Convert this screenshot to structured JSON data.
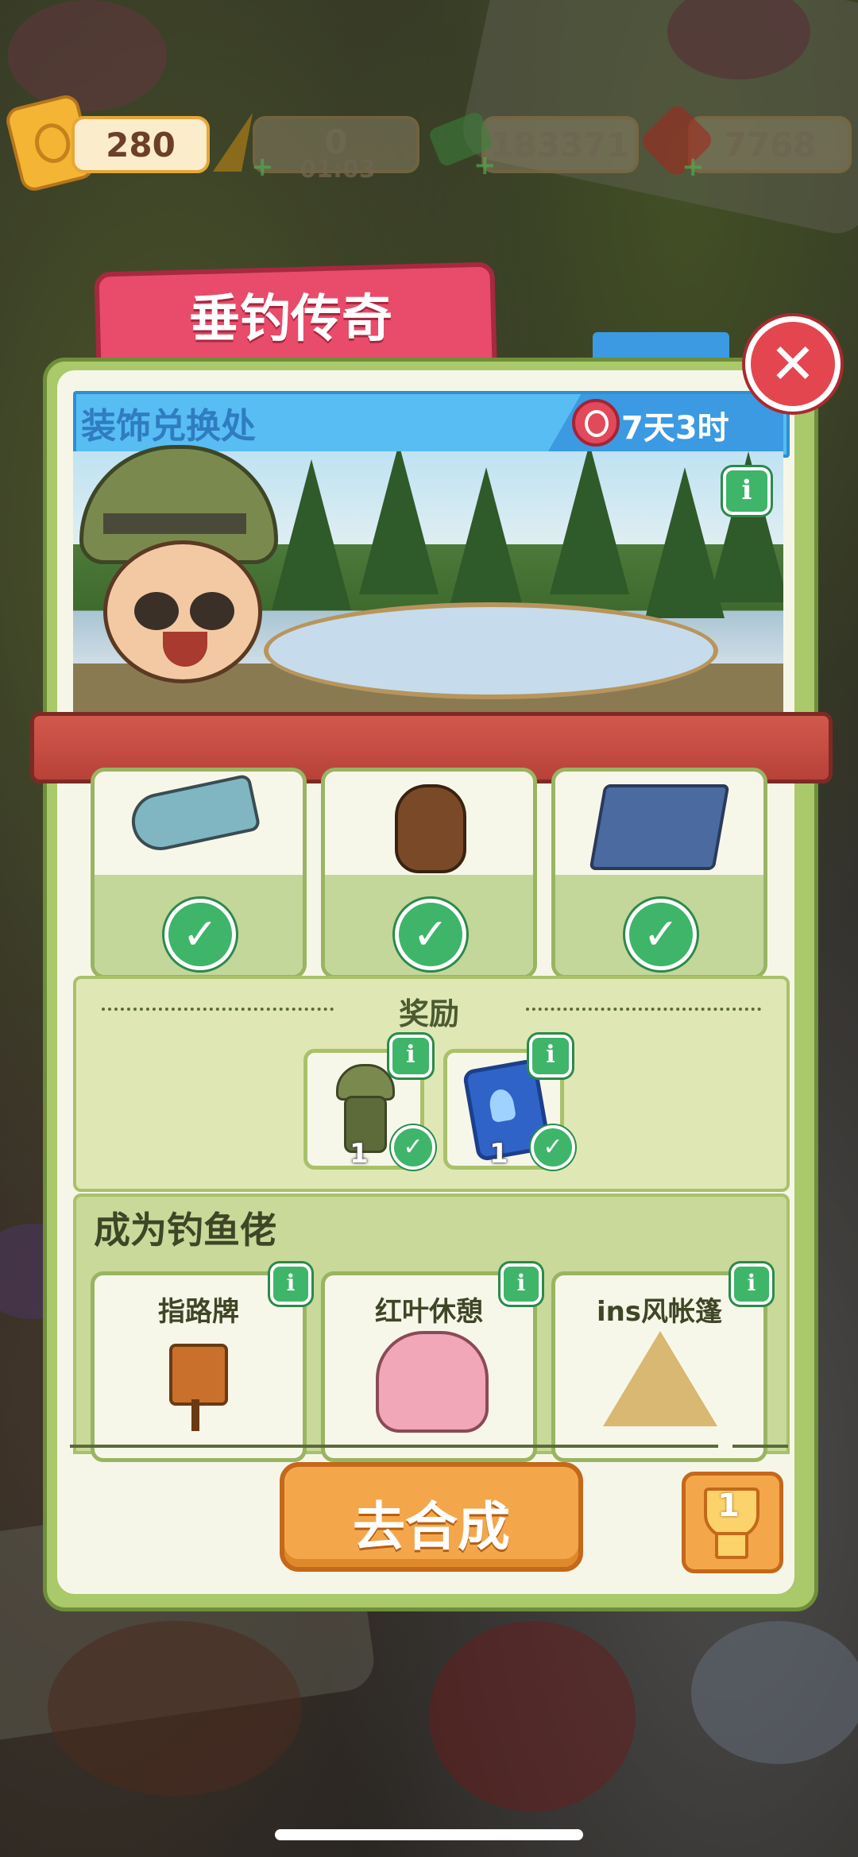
{
  "resources": {
    "tickets": "280",
    "energy": "0",
    "energy_timer": "01:03",
    "cash": "183371",
    "gems": "7768"
  },
  "dialog": {
    "title": "垂钓传奇",
    "close_icon": "close-icon"
  },
  "exchange": {
    "label": "装饰兑换处",
    "remaining": "7天3时"
  },
  "collected_items": [
    {
      "name": "fish",
      "status": "completed"
    },
    {
      "name": "bear-with-fish",
      "status": "completed"
    },
    {
      "name": "fishing-dock",
      "status": "completed"
    }
  ],
  "rewards": {
    "title": "奖励",
    "items": [
      {
        "name": "fisher-avatar",
        "count": "1",
        "claimed": true
      },
      {
        "name": "upgrade-card",
        "count": "1",
        "claimed": true
      }
    ]
  },
  "collection": {
    "title": "成为钓鱼佬",
    "items": [
      {
        "label": "指路牌"
      },
      {
        "label": "红叶休憩"
      },
      {
        "label": "ins风帐篷"
      }
    ]
  },
  "actions": {
    "go_merge": "去合成",
    "trophy_count": "1"
  },
  "colors": {
    "banner": "#e84c6a",
    "panel": "#a9c96a",
    "header": "#58bdf2",
    "primary_button": "#f3a74a",
    "check": "#3fb56a",
    "close": "#e4464f"
  }
}
